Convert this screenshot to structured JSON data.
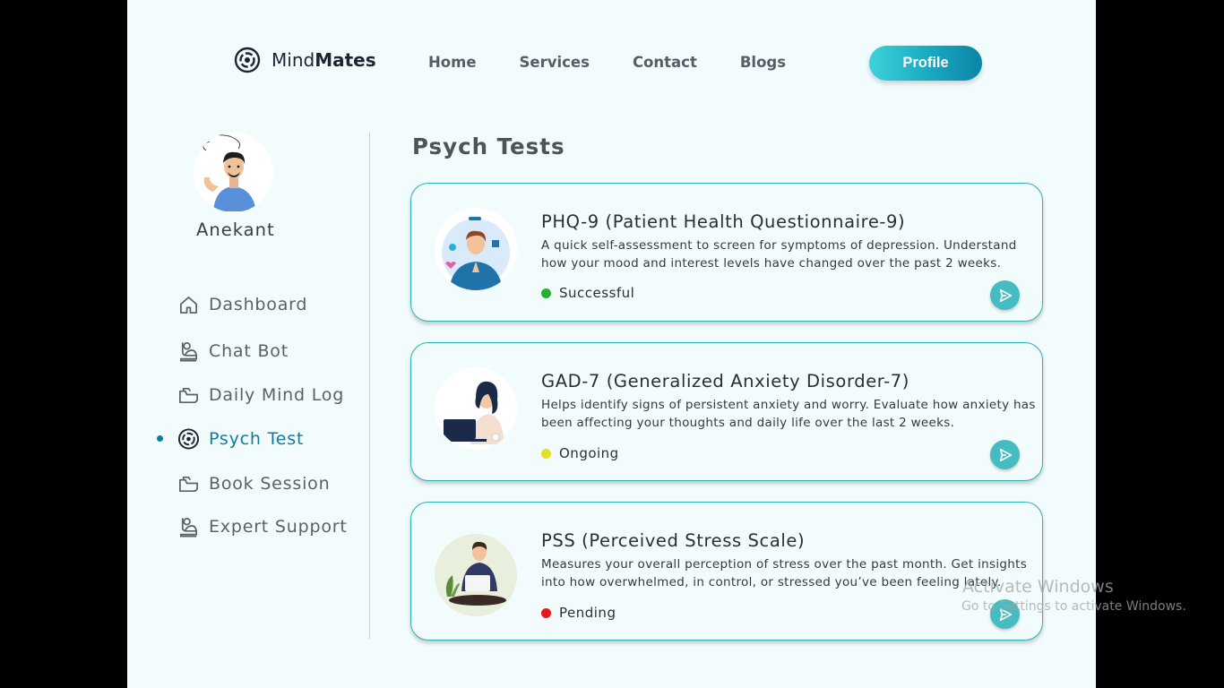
{
  "brand": {
    "name_light": "Mind",
    "name_bold": "Mates"
  },
  "nav": {
    "items": [
      "Home",
      "Services",
      "Contact",
      "Blogs"
    ],
    "profile_label": "Profile"
  },
  "user": {
    "name": "Anekant"
  },
  "sidebar": {
    "items": [
      {
        "label": "Dashboard",
        "icon": "home-icon"
      },
      {
        "label": "Chat Bot",
        "icon": "chatbot-icon"
      },
      {
        "label": "Daily Mind Log",
        "icon": "folder-icon"
      },
      {
        "label": "Psych Test",
        "icon": "target-icon",
        "active": true
      },
      {
        "label": "Book Session",
        "icon": "folder-icon"
      },
      {
        "label": "Expert Support",
        "icon": "chatbot-icon"
      }
    ]
  },
  "main": {
    "title": "Psych Tests",
    "tests": [
      {
        "title": "PHQ-9 (Patient Health Questionnaire-9)",
        "description": "A quick self-assessment to screen for symptoms of depression. Understand how your mood and interest levels have changed over the past 2 weeks.",
        "status": "Successful",
        "status_color": "#2aae2f"
      },
      {
        "title": "GAD-7 (Generalized Anxiety Disorder-7)",
        "description": "Helps identify signs of persistent anxiety and worry. Evaluate how anxiety has been affecting your thoughts and daily life over the last 2 weeks.",
        "status": "Ongoing",
        "status_color": "#e2e02a"
      },
      {
        "title": "PSS (Perceived Stress Scale)",
        "description": "Measures your overall perception of stress over the past month. Get insights into how overwhelmed, in control, or stressed you’ve been feeling lately.",
        "status": "Pending",
        "status_color": "#e31b1b"
      }
    ]
  },
  "watermark": {
    "line1": "Activate Windows",
    "line2": "Go to Settings to activate Windows."
  },
  "colors": {
    "accent": "#0f7c9c",
    "card_border": "#2bb3bd",
    "button": "#45bcc2"
  }
}
